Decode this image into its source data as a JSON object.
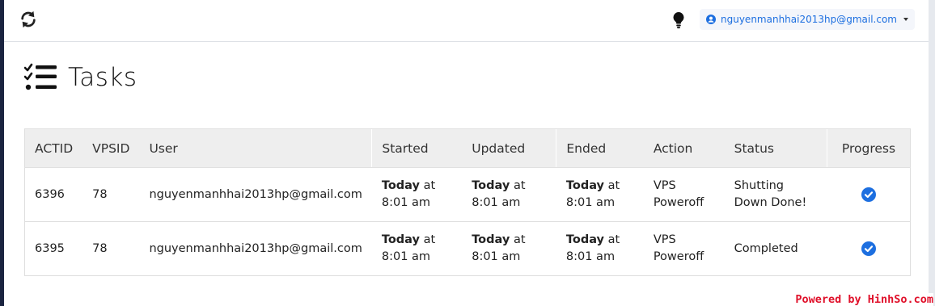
{
  "topbar": {
    "refresh_icon": "refresh-icon",
    "bulb_icon": "lightbulb-icon",
    "user_icon": "user-circle-icon",
    "user_email": "nguyenmanhhai2013hp@gmail.com",
    "accent": "#1d6fe0"
  },
  "page": {
    "title": "Tasks",
    "title_icon": "tasks-list-icon"
  },
  "table": {
    "headers": [
      "ACTID",
      "VPSID",
      "User",
      "Started",
      "Updated",
      "Ended",
      "Action",
      "Status",
      "Progress"
    ],
    "rows": [
      {
        "actid": "6396",
        "vpsid": "78",
        "user": "nguyenmanhhai2013hp@gmail.com",
        "started_day": "Today",
        "started_time": "at 8:01 am",
        "updated_day": "Today",
        "updated_time": "at 8:01 am",
        "ended_day": "Today",
        "ended_time": "at 8:01 am",
        "action": "VPS Poweroff",
        "status": "Shutting Down Done!",
        "progress_icon": "check-circle-icon"
      },
      {
        "actid": "6395",
        "vpsid": "78",
        "user": "nguyenmanhhai2013hp@gmail.com",
        "started_day": "Today",
        "started_time": "at 8:01 am",
        "updated_day": "Today",
        "updated_time": "at 8:01 am",
        "ended_day": "Today",
        "ended_time": "at 8:01 am",
        "action": "VPS Poweroff",
        "status": "Completed",
        "progress_icon": "check-circle-icon"
      }
    ]
  },
  "watermark": "Powered by HinhSo.com"
}
